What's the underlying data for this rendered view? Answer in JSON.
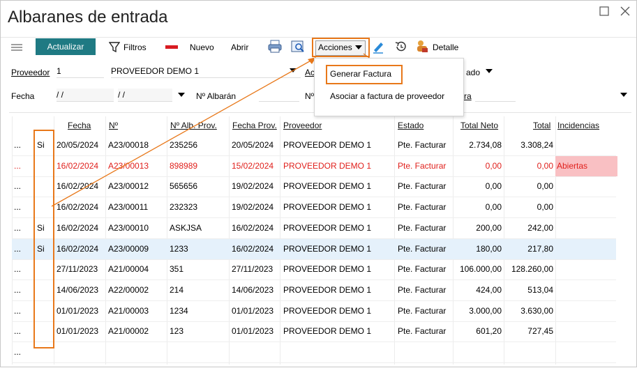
{
  "window": {
    "title": "Albaranes de entrada"
  },
  "toolbar": {
    "actualizar": "Actualizar",
    "filtros": "Filtros",
    "nuevo": "Nuevo",
    "abrir": "Abrir",
    "acciones": "Acciones",
    "detalle": "Detalle"
  },
  "filters": {
    "proveedor_label": "Proveedor",
    "proveedor_code": "1",
    "proveedor_name": "PROVEEDOR DEMO 1",
    "fecha_label": "Fecha",
    "fecha_from": "/ /",
    "fecha_to": "/ /",
    "albaran_label": "Nº Albarán",
    "estado_partial": "ado",
    "ac_partial": "Ac",
    "n_partial": "Nº",
    "ra_partial": "ra"
  },
  "menu": {
    "items": [
      "Generar Factura",
      "Asociar a factura de proveedor"
    ]
  },
  "table": {
    "columns": [
      "Fecha",
      "Nº",
      "Nº Alb. Prov.",
      "Fecha Prov.",
      "Proveedor",
      "Estado",
      "Total Neto",
      "Total",
      "Incidencias"
    ],
    "rows": [
      {
        "menu": "...",
        "si": "Si",
        "fecha": "20/05/2024",
        "num": "A23/00018",
        "alb": "235256",
        "fprov": "20/05/2024",
        "prov": "PROVEEDOR DEMO 1",
        "estado": "Pte. Facturar",
        "neto": "2.734,08",
        "total": "3.308,24",
        "inc": ""
      },
      {
        "menu": "...",
        "si": "",
        "fecha": "16/02/2024",
        "num": "A23/00013",
        "alb": "898989",
        "fprov": "15/02/2024",
        "prov": "PROVEEDOR DEMO 1",
        "estado": "Pte. Facturar",
        "neto": "0,00",
        "total": "0,00",
        "inc": "Abiertas"
      },
      {
        "menu": "...",
        "si": "",
        "fecha": "16/02/2024",
        "num": "A23/00012",
        "alb": "565656",
        "fprov": "19/02/2024",
        "prov": "PROVEEDOR DEMO 1",
        "estado": "Pte. Facturar",
        "neto": "0,00",
        "total": "0,00",
        "inc": ""
      },
      {
        "menu": "...",
        "si": "",
        "fecha": "16/02/2024",
        "num": "A23/00011",
        "alb": "232323",
        "fprov": "19/02/2024",
        "prov": "PROVEEDOR DEMO 1",
        "estado": "Pte. Facturar",
        "neto": "0,00",
        "total": "0,00",
        "inc": ""
      },
      {
        "menu": "...",
        "si": "Si",
        "fecha": "16/02/2024",
        "num": "A23/00010",
        "alb": "ASKJSA",
        "fprov": "16/02/2024",
        "prov": "PROVEEDOR DEMO 1",
        "estado": "Pte. Facturar",
        "neto": "200,00",
        "total": "242,00",
        "inc": ""
      },
      {
        "menu": "...",
        "si": "Si",
        "fecha": "16/02/2024",
        "num": "A23/00009",
        "alb": "1233",
        "fprov": "16/02/2024",
        "prov": "PROVEEDOR DEMO 1",
        "estado": "Pte. Facturar",
        "neto": "180,00",
        "total": "217,80",
        "inc": ""
      },
      {
        "menu": "...",
        "si": "",
        "fecha": "27/11/2023",
        "num": "A21/00004",
        "alb": "351",
        "fprov": "27/11/2023",
        "prov": "PROVEEDOR DEMO 1",
        "estado": "Pte. Facturar",
        "neto": "106.000,00",
        "total": "128.260,00",
        "inc": ""
      },
      {
        "menu": "...",
        "si": "",
        "fecha": "14/06/2023",
        "num": "A22/00002",
        "alb": "214",
        "fprov": "14/06/2023",
        "prov": "PROVEEDOR DEMO 1",
        "estado": "Pte. Facturar",
        "neto": "424,00",
        "total": "513,04",
        "inc": ""
      },
      {
        "menu": "...",
        "si": "",
        "fecha": "01/01/2023",
        "num": "A21/00003",
        "alb": "1234",
        "fprov": "01/01/2023",
        "prov": "PROVEEDOR DEMO 1",
        "estado": "Pte. Facturar",
        "neto": "3.000,00",
        "total": "3.630,00",
        "inc": ""
      },
      {
        "menu": "...",
        "si": "",
        "fecha": "01/01/2023",
        "num": "A21/00002",
        "alb": "123",
        "fprov": "01/01/2023",
        "prov": "PROVEEDOR DEMO 1",
        "estado": "Pte. Facturar",
        "neto": "601,20",
        "total": "727,45",
        "inc": ""
      },
      {
        "menu": "...",
        "si": "",
        "fecha": "",
        "num": "",
        "alb": "",
        "fprov": "",
        "prov": "",
        "estado": "",
        "neto": "",
        "total": "",
        "inc": ""
      }
    ]
  },
  "colors": {
    "accent": "#1f7a83",
    "highlight": "#e8781a",
    "error": "#e0201c",
    "incidence_bg": "#f9c0c3",
    "selected_row": "#e5f1fb"
  }
}
